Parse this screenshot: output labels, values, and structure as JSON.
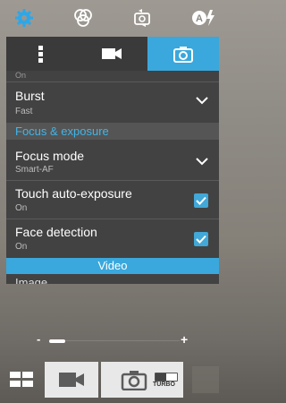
{
  "top_icons": [
    "settings-gear-icon",
    "color-effects-icon",
    "switch-camera-icon",
    "auto-flash-icon"
  ],
  "tabs": [
    "more-options",
    "video",
    "camera"
  ],
  "active_tab": "camera",
  "settings": {
    "top_cut_value": "On",
    "burst": {
      "label": "Burst",
      "value": "Fast"
    },
    "section_focus": "Focus & exposure",
    "focus_mode": {
      "label": "Focus mode",
      "value": "Smart-AF"
    },
    "touch_ae": {
      "label": "Touch auto-exposure",
      "value": "On",
      "checked": true
    },
    "face_detection": {
      "label": "Face detection",
      "value": "On",
      "checked": true
    },
    "section_video": "Video",
    "bottom_cut_label": "Image"
  },
  "zoom": {
    "minus": "-",
    "plus": "+",
    "level": 0.07
  },
  "bottom": {
    "turbo_label": "TURBO"
  },
  "colors": {
    "accent": "#3aa8dc",
    "panel": "#424242"
  }
}
